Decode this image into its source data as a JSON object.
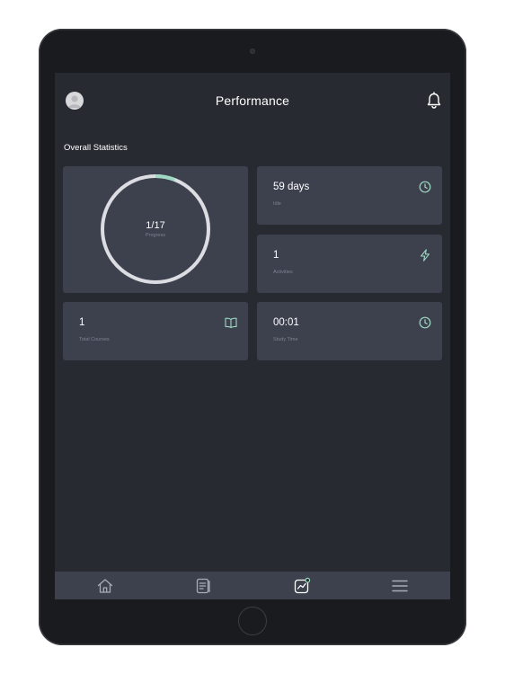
{
  "header": {
    "title": "Performance"
  },
  "section": {
    "title": "Overall Statistics"
  },
  "stats": {
    "progress": {
      "value": "1/17",
      "label": "Progress",
      "fraction": 0.0588
    },
    "idle": {
      "value": "59 days",
      "label": "Idle",
      "icon": "clock-icon"
    },
    "activities": {
      "value": "1",
      "label": "Activities",
      "icon": "lightning-icon"
    },
    "courses": {
      "value": "1",
      "label": "Total Courses",
      "icon": "book-icon"
    },
    "study_time": {
      "value": "00:01",
      "label": "Study Time",
      "icon": "clock-icon"
    }
  },
  "nav": {
    "items": [
      {
        "name": "home",
        "icon": "home-icon"
      },
      {
        "name": "notes",
        "icon": "notes-icon"
      },
      {
        "name": "performance",
        "icon": "chart-icon",
        "active": true
      },
      {
        "name": "menu",
        "icon": "menu-icon"
      }
    ]
  },
  "colors": {
    "screen_bg": "#272a31",
    "card_bg": "#3d404d",
    "accent": "#9fd9c4",
    "ring": "#dcdde2",
    "muted_text": "#7f8391"
  }
}
